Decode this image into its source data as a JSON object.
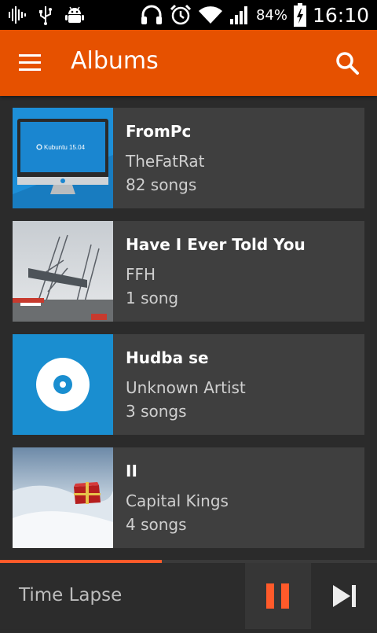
{
  "status_bar": {
    "battery_percent": "84%",
    "time": "16:10",
    "icons": [
      "audio-wave-icon",
      "usb-icon",
      "android-debug-icon",
      "headphones-icon",
      "alarm-icon",
      "wifi-icon",
      "signal-icon",
      "battery-charging-icon"
    ]
  },
  "app_bar": {
    "title": "Albums",
    "color": "#e65100",
    "icons": [
      "menu-icon",
      "search-icon"
    ]
  },
  "albums": [
    {
      "title": "FromPc",
      "artist": "TheFatRat",
      "count": "82 songs",
      "art": "kubuntu-monitor-art",
      "art_text": "Kubuntu 15.04"
    },
    {
      "title": "Have I Ever Told You",
      "artist": "FFH",
      "count": "1 song",
      "art": "construction-photo-art"
    },
    {
      "title": "Hudba se",
      "artist": "Unknown Artist",
      "count": "3 songs",
      "art": "vinyl-disc-art"
    },
    {
      "title": "II",
      "artist": "Capital Kings",
      "count": "4 songs",
      "art": "snow-gift-photo-art"
    }
  ],
  "now_playing": {
    "track": "Time Lapse",
    "progress": 0.43,
    "accent": "#ff5a2a",
    "icons": [
      "pause-icon",
      "skip-next-icon"
    ]
  }
}
